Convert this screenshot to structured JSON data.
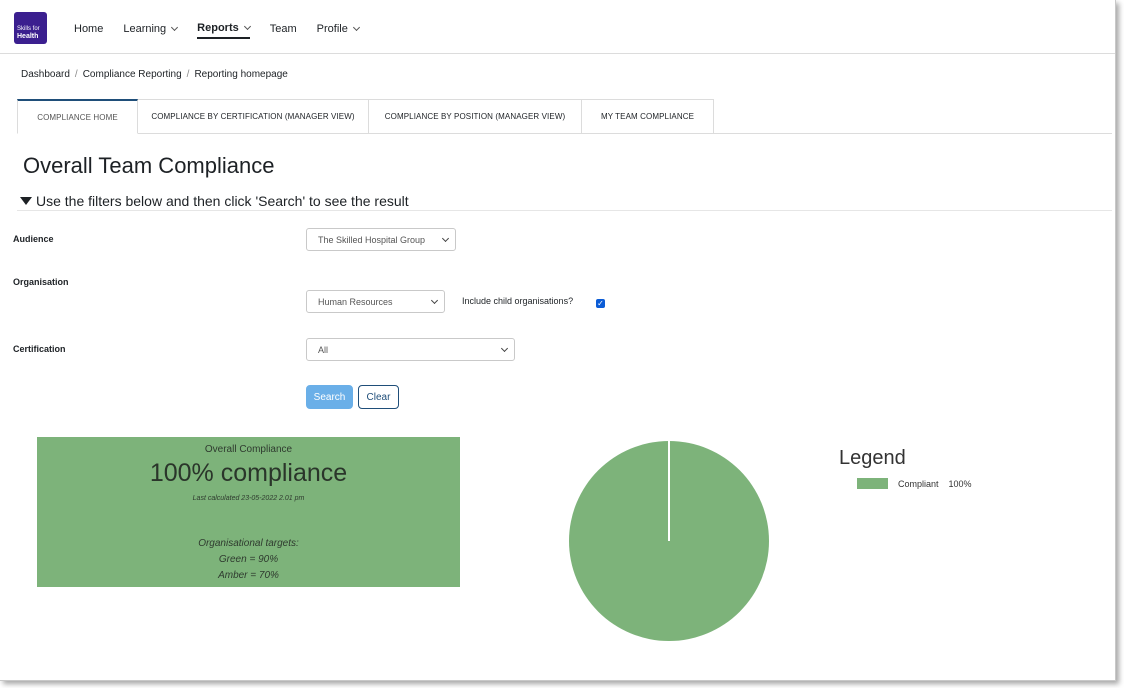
{
  "brand": {
    "line1": "Skills for",
    "line2": "Health"
  },
  "nav": [
    {
      "label": "Home",
      "has_menu": false,
      "active": false
    },
    {
      "label": "Learning",
      "has_menu": true,
      "active": false
    },
    {
      "label": "Reports",
      "has_menu": true,
      "active": true
    },
    {
      "label": "Team",
      "has_menu": false,
      "active": false
    },
    {
      "label": "Profile",
      "has_menu": true,
      "active": false
    }
  ],
  "breadcrumb": [
    "Dashboard",
    "Compliance Reporting",
    "Reporting homepage"
  ],
  "tabs": [
    {
      "label": "COMPLIANCE HOME",
      "active": true
    },
    {
      "label": "COMPLIANCE BY CERTIFICATION (MANAGER VIEW)",
      "active": false
    },
    {
      "label": "COMPLIANCE BY POSITION (MANAGER VIEW)",
      "active": false
    },
    {
      "label": "MY TEAM COMPLIANCE",
      "active": false
    }
  ],
  "page_title": "Overall Team Compliance",
  "filter_toggle": "Use the filters below and then click 'Search' to see the result",
  "filters": {
    "audience": {
      "label": "Audience",
      "value": "The Skilled Hospital Group"
    },
    "organisation": {
      "label": "Organisation",
      "value": "Human Resources",
      "include_child_label": "Include child organisations?",
      "include_child_checked": true
    },
    "certification": {
      "label": "Certification",
      "value": "All"
    }
  },
  "buttons": {
    "search": "Search",
    "clear": "Clear"
  },
  "summary": {
    "label": "Overall Compliance",
    "headline": "100% compliance",
    "last_calculated": "Last calculated 23-05-2022 2.01 pm",
    "targets_title": "Organisational targets:",
    "green_target": "Green = 90%",
    "amber_target": "Amber = 70%"
  },
  "chart_data": {
    "type": "pie",
    "categories": [
      "Compliant"
    ],
    "values": [
      100
    ],
    "colors": [
      "#7db37a"
    ]
  },
  "legend": {
    "title": "Legend",
    "items": [
      {
        "name": "Compliant",
        "value": "100%",
        "color": "#7db37a"
      }
    ]
  },
  "colors": {
    "compliant": "#7db37a",
    "accent": "#1f4e79",
    "search_button": "#6aafe8",
    "brand": "#3b1f8f"
  }
}
